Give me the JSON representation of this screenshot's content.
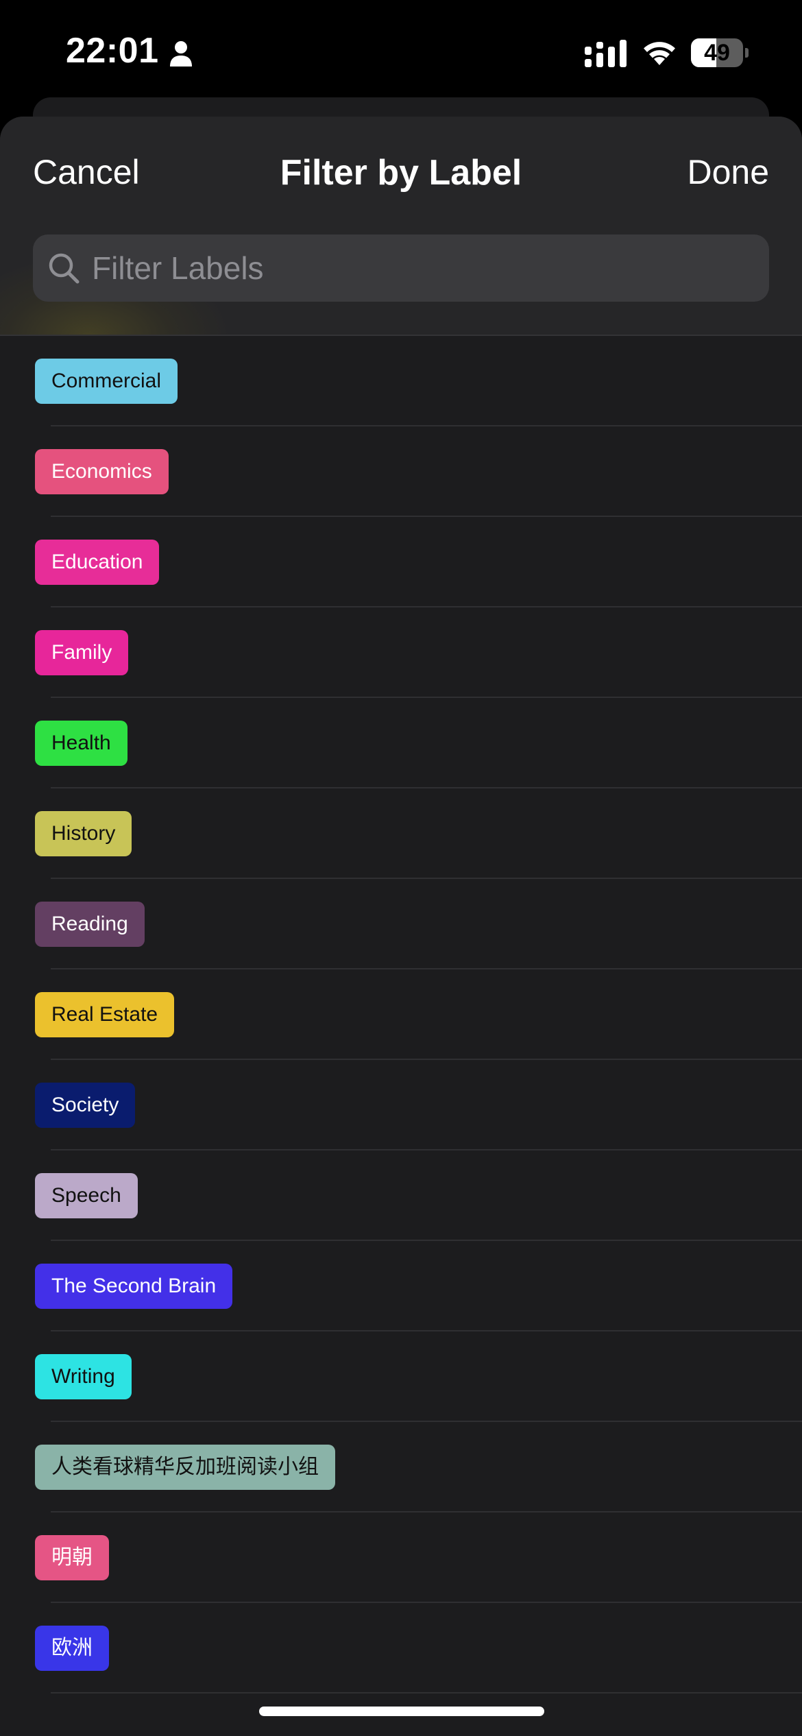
{
  "status_bar": {
    "time": "22:01",
    "battery_level": "49",
    "battery_fraction": 0.49,
    "icons": [
      "person-icon",
      "signal-icon",
      "wifi-icon",
      "battery-icon"
    ]
  },
  "header": {
    "cancel_label": "Cancel",
    "title": "Filter by Label",
    "done_label": "Done"
  },
  "search": {
    "placeholder": "Filter Labels",
    "value": "",
    "icon": "search-icon"
  },
  "labels": [
    {
      "text": "Commercial",
      "bg": "#6dcbe6",
      "fg": "#111111"
    },
    {
      "text": "Economics",
      "bg": "#e5527e",
      "fg": "#ffffff"
    },
    {
      "text": "Education",
      "bg": "#e72d98",
      "fg": "#ffffff"
    },
    {
      "text": "Family",
      "bg": "#e7269a",
      "fg": "#ffffff"
    },
    {
      "text": "Health",
      "bg": "#2ee043",
      "fg": "#111111"
    },
    {
      "text": "History",
      "bg": "#c8c457",
      "fg": "#111111"
    },
    {
      "text": "Reading",
      "bg": "#633f62",
      "fg": "#ffffff"
    },
    {
      "text": "Real Estate",
      "bg": "#ebc12d",
      "fg": "#111111"
    },
    {
      "text": "Society",
      "bg": "#0a1c6e",
      "fg": "#ffffff"
    },
    {
      "text": "Speech",
      "bg": "#bba9c9",
      "fg": "#111111"
    },
    {
      "text": "The Second Brain",
      "bg": "#4330e8",
      "fg": "#ffffff"
    },
    {
      "text": "Writing",
      "bg": "#2de3e3",
      "fg": "#111111"
    },
    {
      "text": "人类看球精华反加班阅读小组",
      "bg": "#8ab3a8",
      "fg": "#111111"
    },
    {
      "text": "明朝",
      "bg": "#e55585",
      "fg": "#ffffff"
    },
    {
      "text": "欧洲",
      "bg": "#3936e8",
      "fg": "#ffffff"
    }
  ]
}
